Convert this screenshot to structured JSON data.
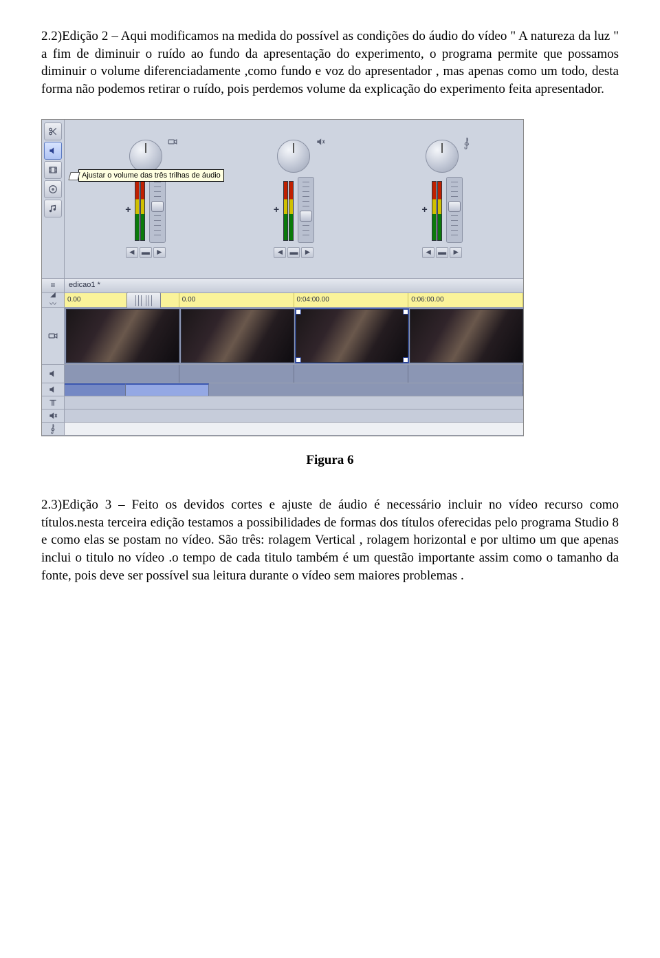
{
  "para1": "2.2)Edição 2 – Aqui  modificamos na medida do possível as condições do áudio do vídeo \" A natureza da luz \" a fim de diminuir o ruído ao fundo da apresentação do experimento, o programa permite que possamos diminuir o volume diferenciadamente ,como fundo e voz do apresentador , mas apenas como um todo, desta forma não podemos retirar o ruído, pois perdemos volume da explicação do experimento feita apresentador.",
  "figure": {
    "tooltip": "Ajustar o volume das três trilhas de áudio",
    "project_name": "edicao1 *",
    "ruler": [
      "0.00",
      "0.00",
      "0:04:00.00",
      "0:06:00.00"
    ],
    "caption": "Figura 6"
  },
  "para2": "2.3)Edição 3 – Feito os devidos cortes e ajuste de áudio é necessário incluir no vídeo recurso como títulos.nesta terceira edição testamos a possibilidades de formas dos títulos oferecidas pelo programa Studio 8 e como elas se postam no vídeo.  São três:  rolagem Vertical , rolagem horizontal e por ultimo um que apenas inclui o titulo no vídeo .o tempo de cada titulo também é um questão importante assim como o tamanho da fonte, pois deve ser possível sua leitura durante o vídeo sem maiores problemas .",
  "icons": {
    "scissors": "scissors-icon",
    "speaker": "speaker-icon",
    "film": "film-icon",
    "disc": "disc-icon",
    "note": "music-note-icon",
    "menu": "menu-icon",
    "triangle": "collapse-icon",
    "wave": "waveform-icon",
    "camera": "camera-icon",
    "title": "title-track-icon",
    "speaker2": "speaker-track-icon",
    "treble": "treble-clef-icon",
    "mute": "mute-icon"
  }
}
